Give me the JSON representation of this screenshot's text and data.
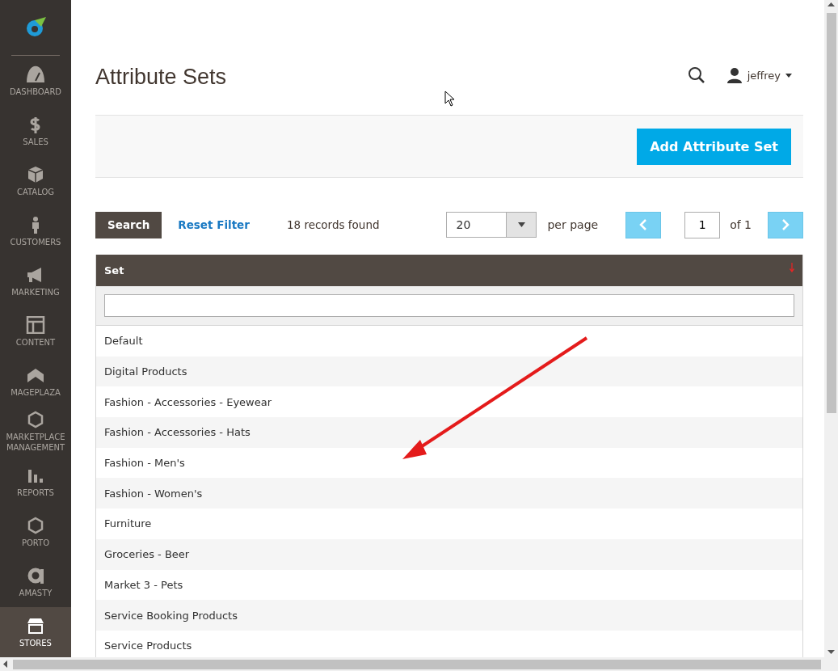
{
  "sidebar": {
    "items": [
      {
        "label": "DASHBOARD",
        "selected": false
      },
      {
        "label": "SALES",
        "selected": false
      },
      {
        "label": "CATALOG",
        "selected": false
      },
      {
        "label": "CUSTOMERS",
        "selected": false
      },
      {
        "label": "MARKETING",
        "selected": false
      },
      {
        "label": "CONTENT",
        "selected": false
      },
      {
        "label": "MAGEPLAZA",
        "selected": false
      },
      {
        "label": "MARKETPLACE MANAGEMENT",
        "selected": false
      },
      {
        "label": "REPORTS",
        "selected": false
      },
      {
        "label": "PORTO",
        "selected": false
      },
      {
        "label": "AMASTY",
        "selected": false
      },
      {
        "label": "STORES",
        "selected": true
      }
    ]
  },
  "header": {
    "title": "Attribute Sets",
    "user": "jeffrey"
  },
  "actions": {
    "add_button": "Add Attribute Set"
  },
  "toolbar": {
    "search_button": "Search",
    "reset_link": "Reset Filter",
    "records": "18 records found",
    "per_page_value": "20",
    "per_page_label": "per page",
    "page": "1",
    "of_pages": "of 1"
  },
  "table": {
    "columns": [
      "Set"
    ],
    "rows": [
      "Default",
      "Digital Products",
      "Fashion - Accessories - Eyewear",
      "Fashion - Accessories - Hats",
      "Fashion - Men's",
      "Fashion - Women's",
      "Furniture",
      "Groceries - Beer",
      "Market 3 - Pets",
      "Service Booking Products",
      "Service Products"
    ]
  }
}
